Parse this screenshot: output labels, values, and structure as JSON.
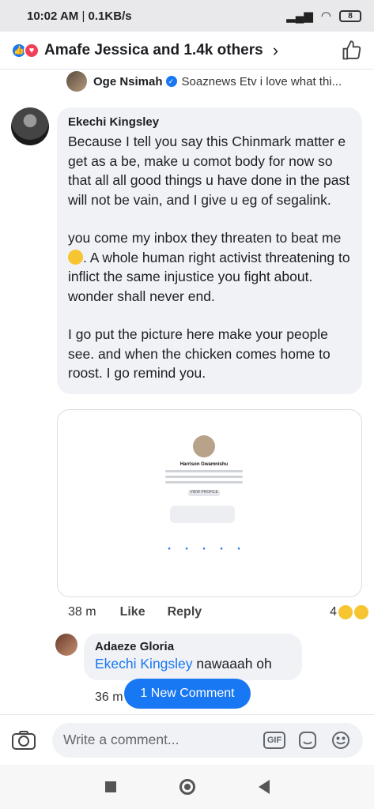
{
  "status_bar": {
    "time": "10:02 AM",
    "speed": "0.1KB/s",
    "battery": "8"
  },
  "reactions_header": {
    "text": "Amafe Jessica and 1.4k others"
  },
  "reply_preview": {
    "name": "Oge Nsimah",
    "snippet": "Soaznews Etv i love what thi..."
  },
  "comment": {
    "author": "Ekechi Kingsley",
    "paragraphs": [
      "Because I tell you say this Chinmark matter e get as a be, make u comot body for now so that all all good things u have done in the past will not be vain, and I give u eg of segalink.",
      "you come my inbox they threaten to beat me",
      ". A whole human right activist threatening to inflict the same injustice you fight about. wonder shall never end.",
      "I go put the picture here make your people see. and when the chicken comes home to roost. I go remind you."
    ],
    "attachment": {
      "profile_name": "Harrison Gwamnishu",
      "button": "VIEW PROFILE"
    },
    "time": "38 m",
    "like_label": "Like",
    "reply_label": "Reply",
    "reaction_count": "4"
  },
  "reply": {
    "author": "Adaeze Gloria",
    "mention": "Ekechi Kingsley",
    "text": " nawaaah oh",
    "time": "36 m"
  },
  "new_comment_pill": "1 New Comment",
  "composer": {
    "placeholder": "Write a comment...",
    "gif_label": "GIF"
  },
  "colors": {
    "accent": "#1877f2",
    "bubble": "#f0f2f5"
  }
}
